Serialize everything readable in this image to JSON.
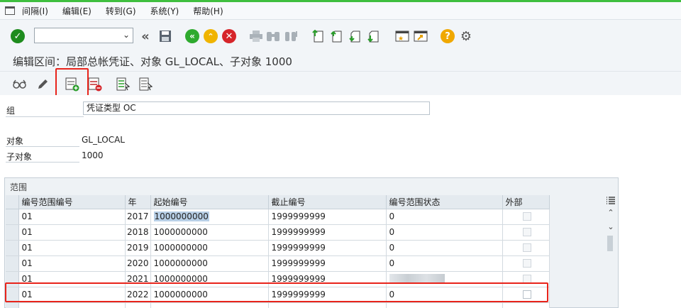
{
  "menu": {
    "items": [
      "间隔(I)",
      "编辑(E)",
      "转到(G)",
      "系统(Y)",
      "帮助(H)"
    ]
  },
  "toolbar": {
    "command_value": "",
    "icons": [
      "check-icon",
      "back-icon",
      "save-icon",
      "nav-back-icon",
      "nav-up-icon",
      "cancel-icon",
      "print-icon",
      "find-icon",
      "find-next-icon",
      "first-page-icon",
      "prev-page-icon",
      "next-page-icon",
      "last-page-icon",
      "new-session-icon",
      "shortcut-icon",
      "help-icon",
      "settings-icon"
    ],
    "colors": {
      "check": "#1e8c1e",
      "nav_green": "#2eaa2e",
      "nav_yellow": "#f0b400",
      "cancel": "#d6252a",
      "help": "#f0a800"
    }
  },
  "page": {
    "title": "编辑区间：局部总帐凭证、对象 GL_LOCAL、子对象 1000"
  },
  "form": {
    "group_label": "组",
    "group_value": "凭证类型 OC",
    "object_label": "对象",
    "object_value": "GL_LOCAL",
    "subobject_label": "子对象",
    "subobject_value": "1000"
  },
  "range": {
    "frame_title": "范围",
    "columns": [
      "编号范围编号",
      "年",
      "起始编号",
      "截止编号",
      "编号范围状态",
      "外部"
    ],
    "rows": [
      {
        "no": "01",
        "year": "2017",
        "from": "1000000000",
        "to": "1999999999",
        "status": "0",
        "external": false
      },
      {
        "no": "01",
        "year": "2018",
        "from": "1000000000",
        "to": "1999999999",
        "status": "0",
        "external": false
      },
      {
        "no": "01",
        "year": "2019",
        "from": "1000000000",
        "to": "1999999999",
        "status": "0",
        "external": false
      },
      {
        "no": "01",
        "year": "2020",
        "from": "1000000000",
        "to": "1999999999",
        "status": "0",
        "external": false
      },
      {
        "no": "01",
        "year": "2021",
        "from": "1000000000",
        "to": "1999999999",
        "status": "",
        "external": false
      },
      {
        "no": "01",
        "year": "2022",
        "from": "1000000000",
        "to": "1999999999",
        "status": "0",
        "external": false
      }
    ]
  },
  "highlight_color": "#e8241b"
}
